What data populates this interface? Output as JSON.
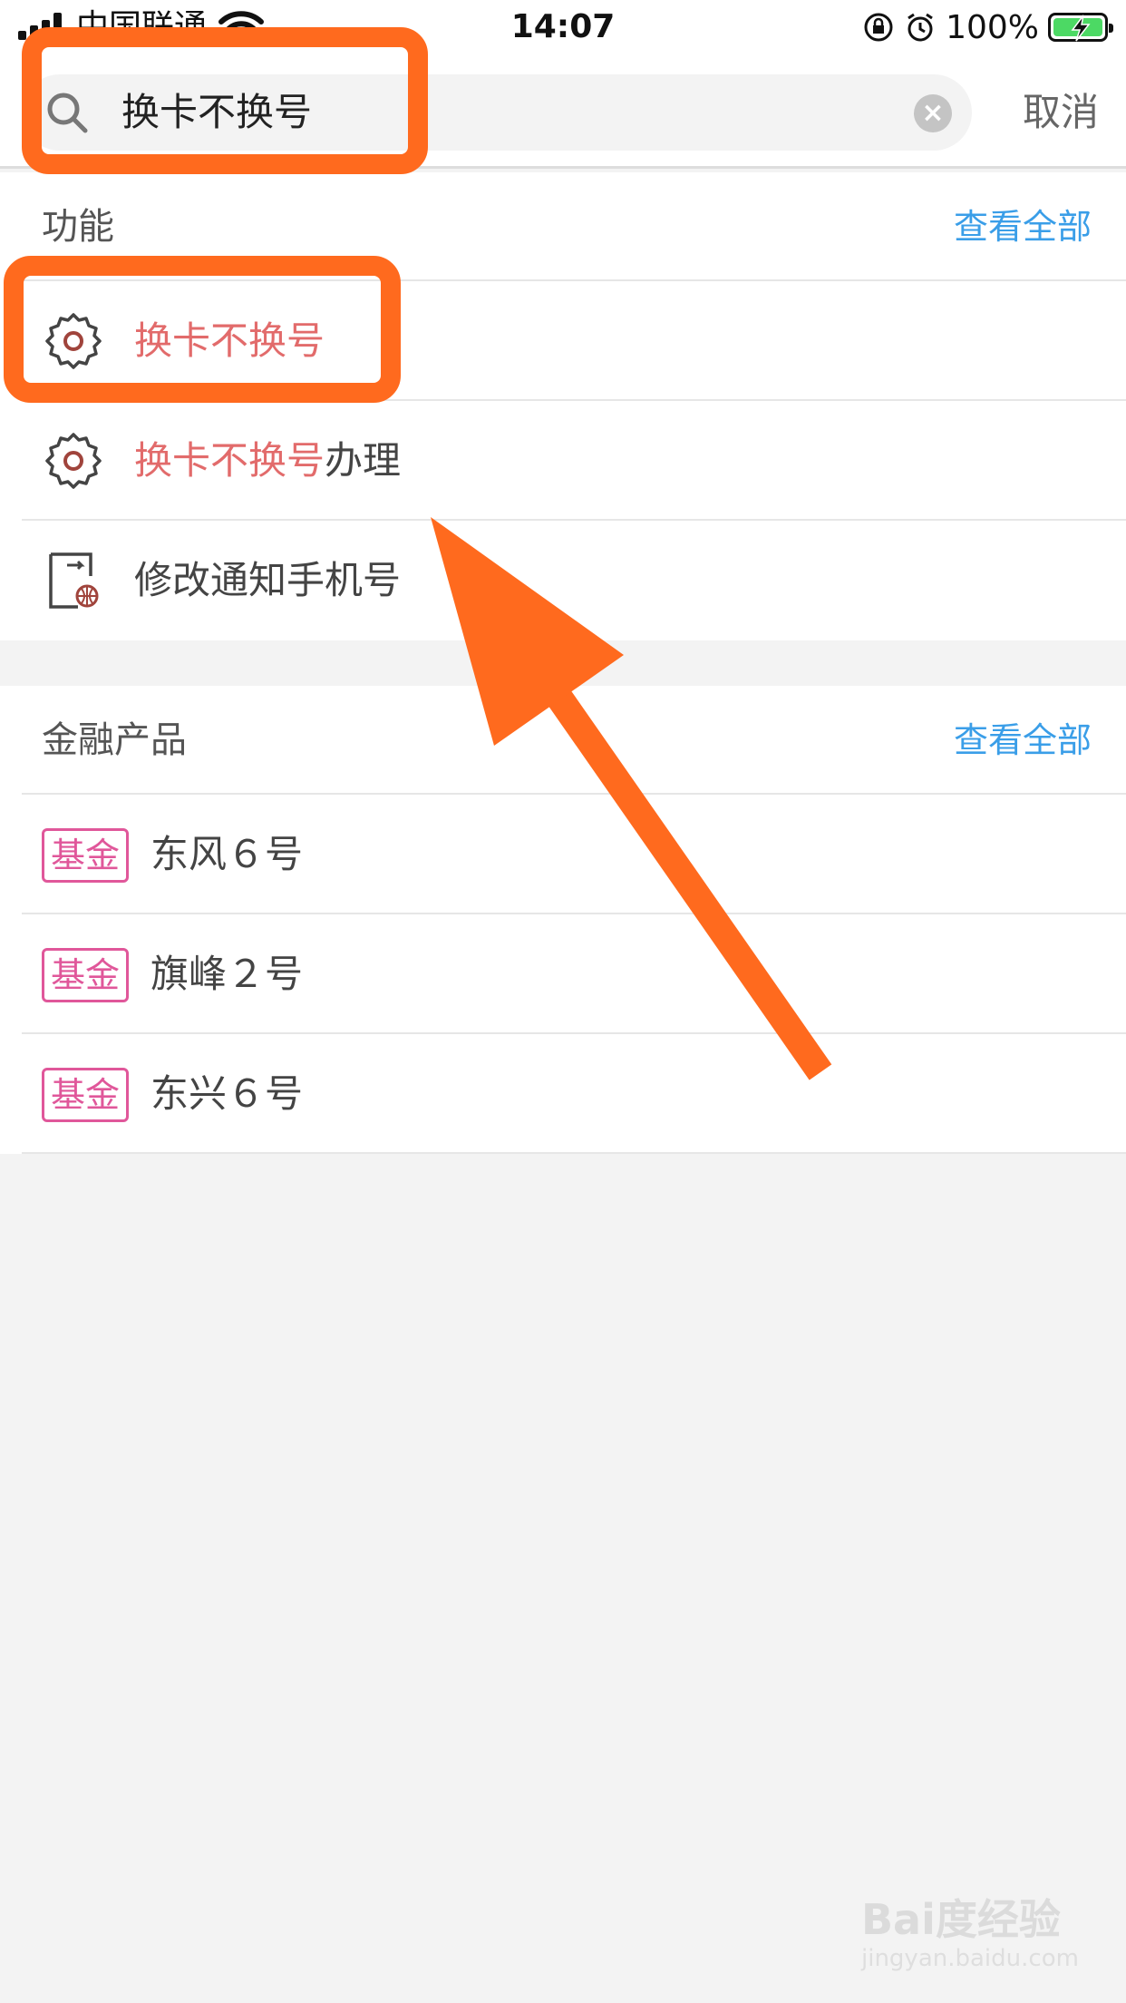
{
  "status_bar": {
    "carrier": "中国联通",
    "time": "14:07",
    "battery_percent": "100%",
    "battery_color": "#4cd964"
  },
  "search": {
    "query": "换卡不换号",
    "cancel_label": "取消",
    "icon": "search-icon",
    "clear_icon": "clear-icon"
  },
  "features_section": {
    "title": "功能",
    "see_all": "查看全部",
    "items": [
      {
        "highlight": "换卡不换号",
        "rest": "",
        "icon": "gear-icon"
      },
      {
        "highlight": "换卡不换号",
        "rest": "办理",
        "icon": "gear-icon"
      },
      {
        "highlight": "",
        "rest": "修改通知手机号",
        "icon": "phone-doc-icon"
      }
    ]
  },
  "finance_section": {
    "title": "金融产品",
    "see_all": "查看全部",
    "items": [
      {
        "tag": "基金",
        "name": "东风６号"
      },
      {
        "tag": "基金",
        "name": "旗峰２号"
      },
      {
        "tag": "基金",
        "name": "东兴６号"
      }
    ]
  },
  "colors": {
    "highlight": "#e26b6b",
    "link": "#3a9ee8",
    "tag": "#e0579a",
    "annotation": "#ff6a1e"
  },
  "watermark": {
    "main": "Bai度经验",
    "sub": "jingyan.baidu.com"
  }
}
